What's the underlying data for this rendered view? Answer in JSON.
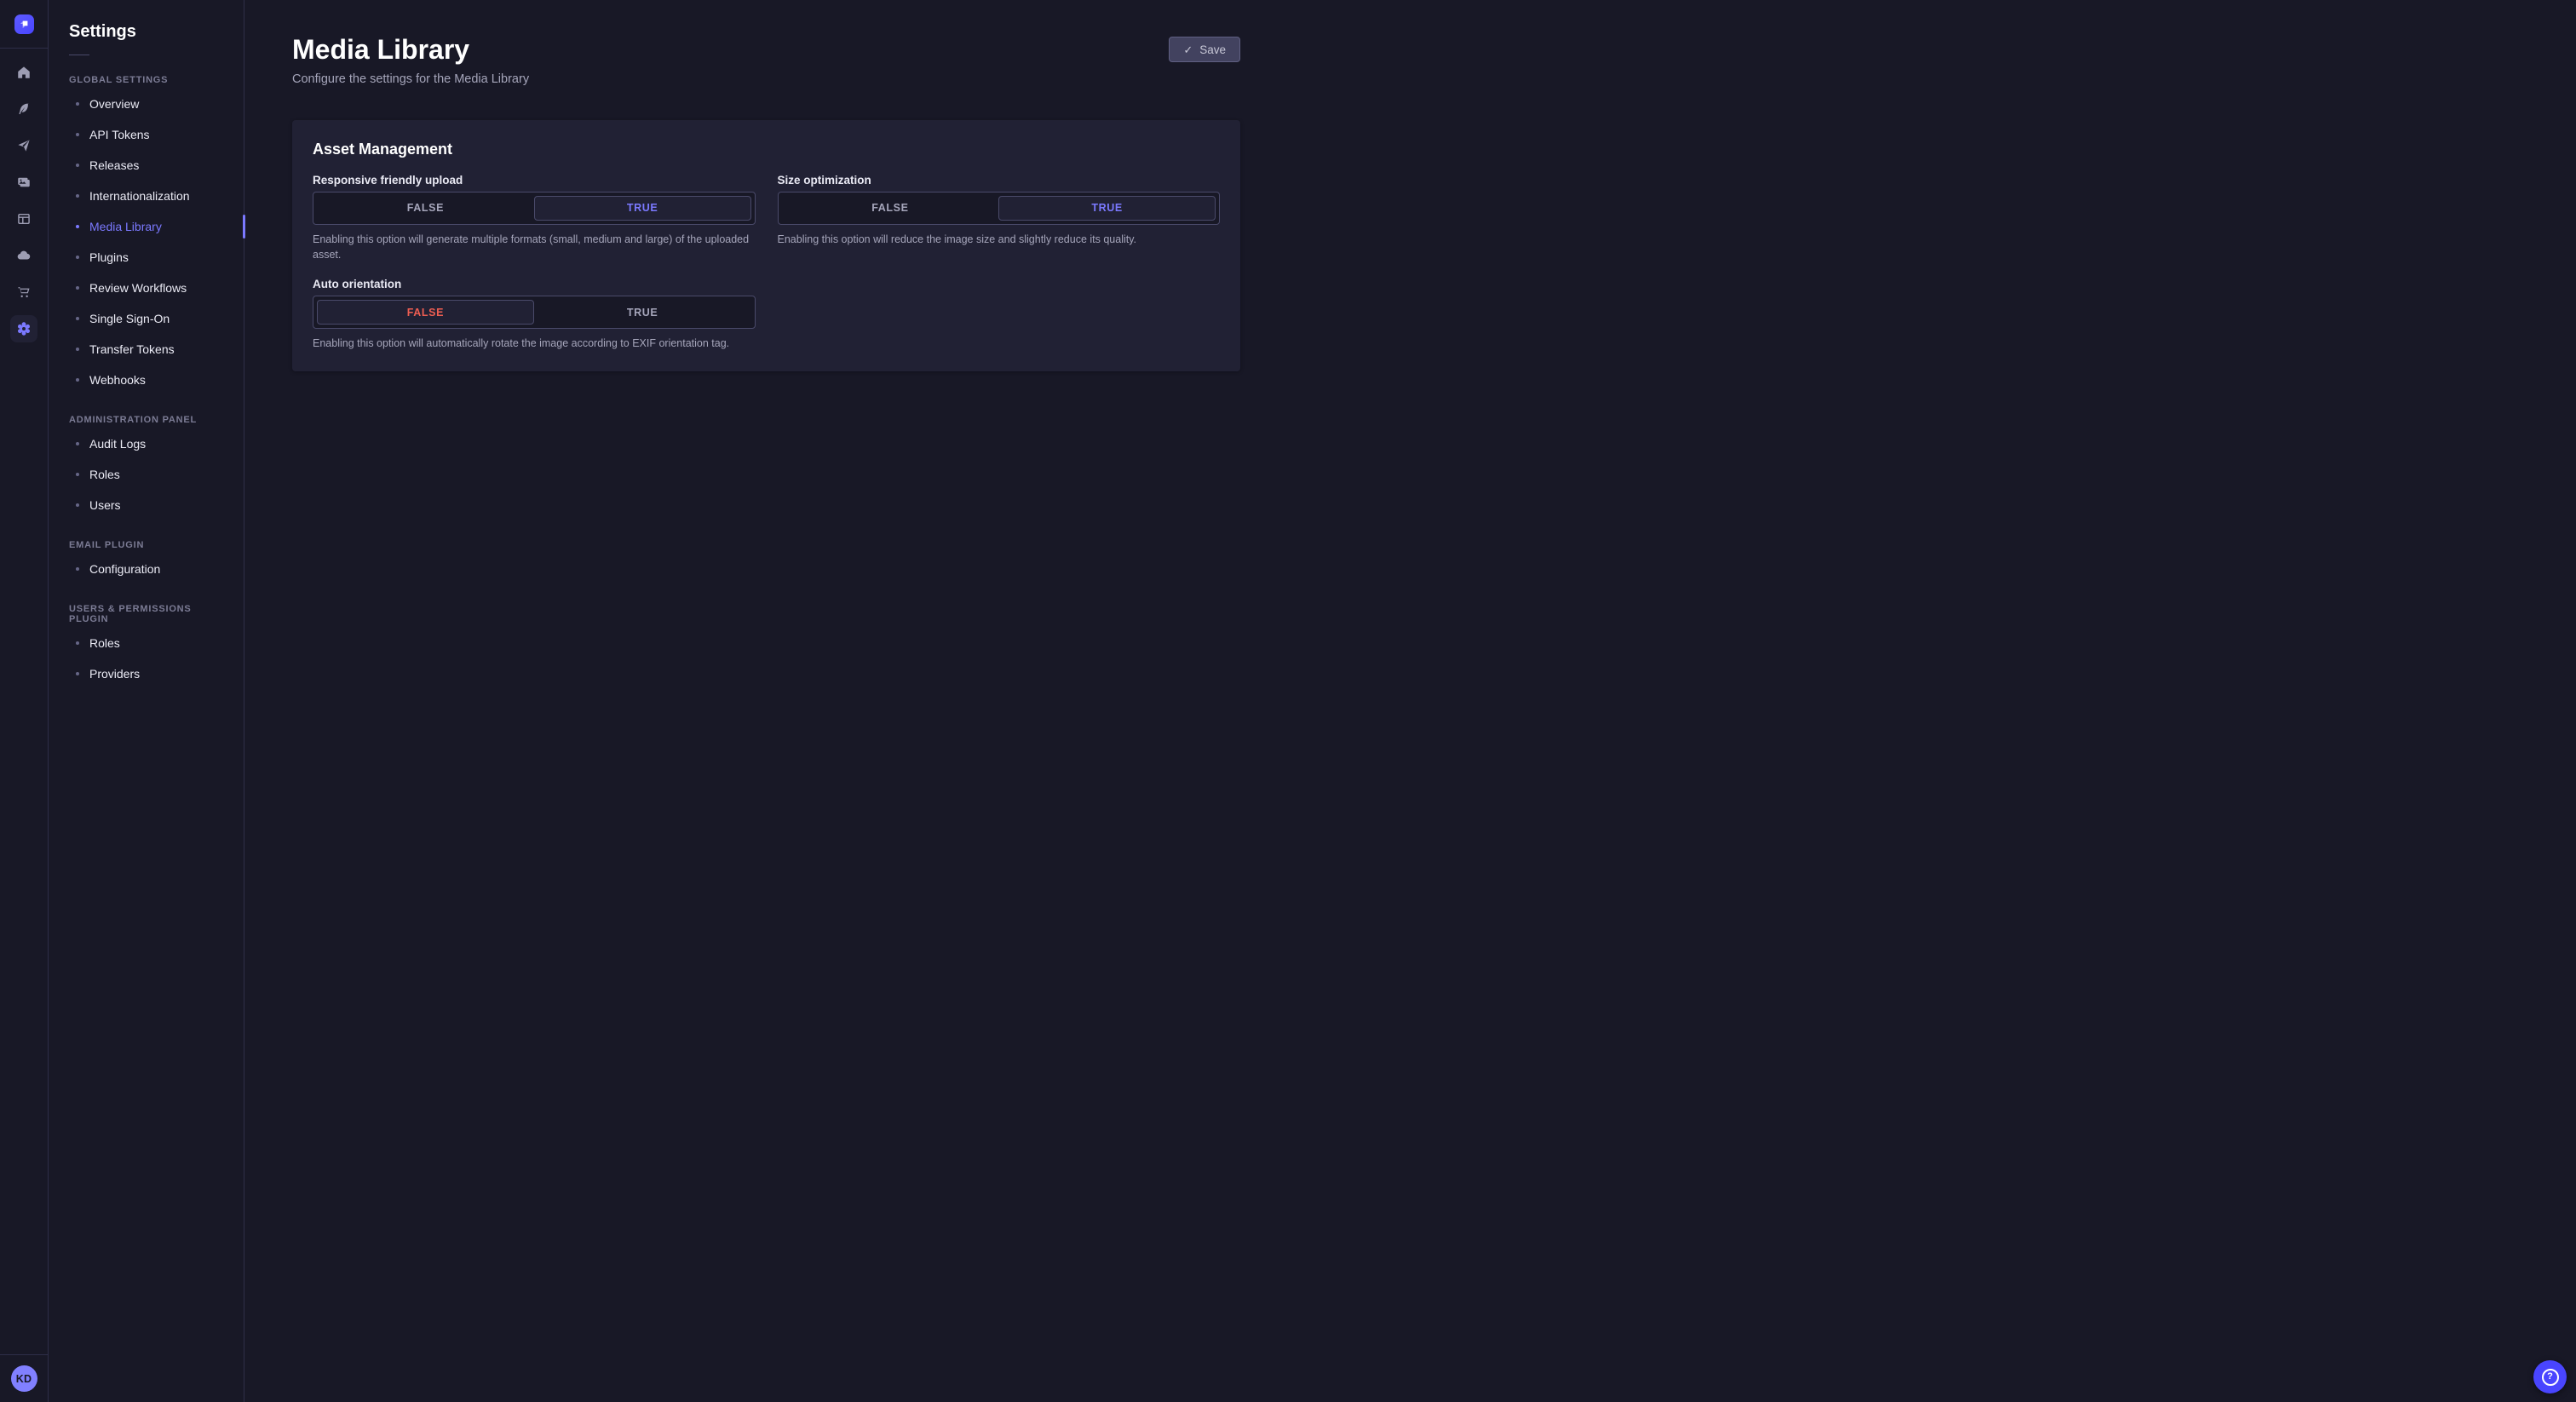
{
  "colors": {
    "background": "#181826",
    "surface": "#212134",
    "accent": "#4945ff",
    "accent_light": "#7b79ff",
    "danger": "#ee5e52",
    "muted_text": "#a5a5ba"
  },
  "rail": {
    "logo_icon": "strapi-logo-icon",
    "icons": [
      {
        "name": "home",
        "active": false
      },
      {
        "name": "feather",
        "active": false
      },
      {
        "name": "paper-plane",
        "active": false
      },
      {
        "name": "media-pictures",
        "active": false
      },
      {
        "name": "layout-panel",
        "active": false
      },
      {
        "name": "cloud",
        "active": false
      },
      {
        "name": "cart",
        "active": false
      },
      {
        "name": "gear",
        "active": true
      }
    ],
    "avatar_initials": "KD"
  },
  "settings_nav": {
    "title": "Settings",
    "sections": [
      {
        "label": "GLOBAL SETTINGS",
        "items": [
          {
            "label": "Overview",
            "active": false
          },
          {
            "label": "API Tokens",
            "active": false
          },
          {
            "label": "Releases",
            "active": false
          },
          {
            "label": "Internationalization",
            "active": false
          },
          {
            "label": "Media Library",
            "active": true
          },
          {
            "label": "Plugins",
            "active": false
          },
          {
            "label": "Review Workflows",
            "active": false
          },
          {
            "label": "Single Sign-On",
            "active": false
          },
          {
            "label": "Transfer Tokens",
            "active": false
          },
          {
            "label": "Webhooks",
            "active": false
          }
        ]
      },
      {
        "label": "ADMINISTRATION PANEL",
        "items": [
          {
            "label": "Audit Logs",
            "active": false
          },
          {
            "label": "Roles",
            "active": false
          },
          {
            "label": "Users",
            "active": false
          }
        ]
      },
      {
        "label": "EMAIL PLUGIN",
        "items": [
          {
            "label": "Configuration",
            "active": false
          }
        ]
      },
      {
        "label": "USERS & PERMISSIONS PLUGIN",
        "items": [
          {
            "label": "Roles",
            "active": false
          },
          {
            "label": "Providers",
            "active": false
          }
        ]
      }
    ]
  },
  "page": {
    "title": "Media Library",
    "subtitle": "Configure the settings for the Media Library"
  },
  "toolbar": {
    "save_label": "Save",
    "save_icon": "checkmark-icon"
  },
  "panel": {
    "title": "Asset Management",
    "toggle_options": [
      "FALSE",
      "TRUE"
    ],
    "fields": [
      {
        "id": "responsive-friendly-upload",
        "label": "Responsive friendly upload",
        "value": "TRUE",
        "hint": "Enabling this option will generate multiple formats (small, medium and large) of the uploaded asset."
      },
      {
        "id": "size-optimization",
        "label": "Size optimization",
        "value": "TRUE",
        "hint": "Enabling this option will reduce the image size and slightly reduce its quality."
      },
      {
        "id": "auto-orientation",
        "label": "Auto orientation",
        "value": "FALSE",
        "hint": "Enabling this option will automatically rotate the image according to EXIF orientation tag."
      }
    ]
  },
  "help": {
    "icon": "question-mark-icon",
    "glyph": "?"
  }
}
